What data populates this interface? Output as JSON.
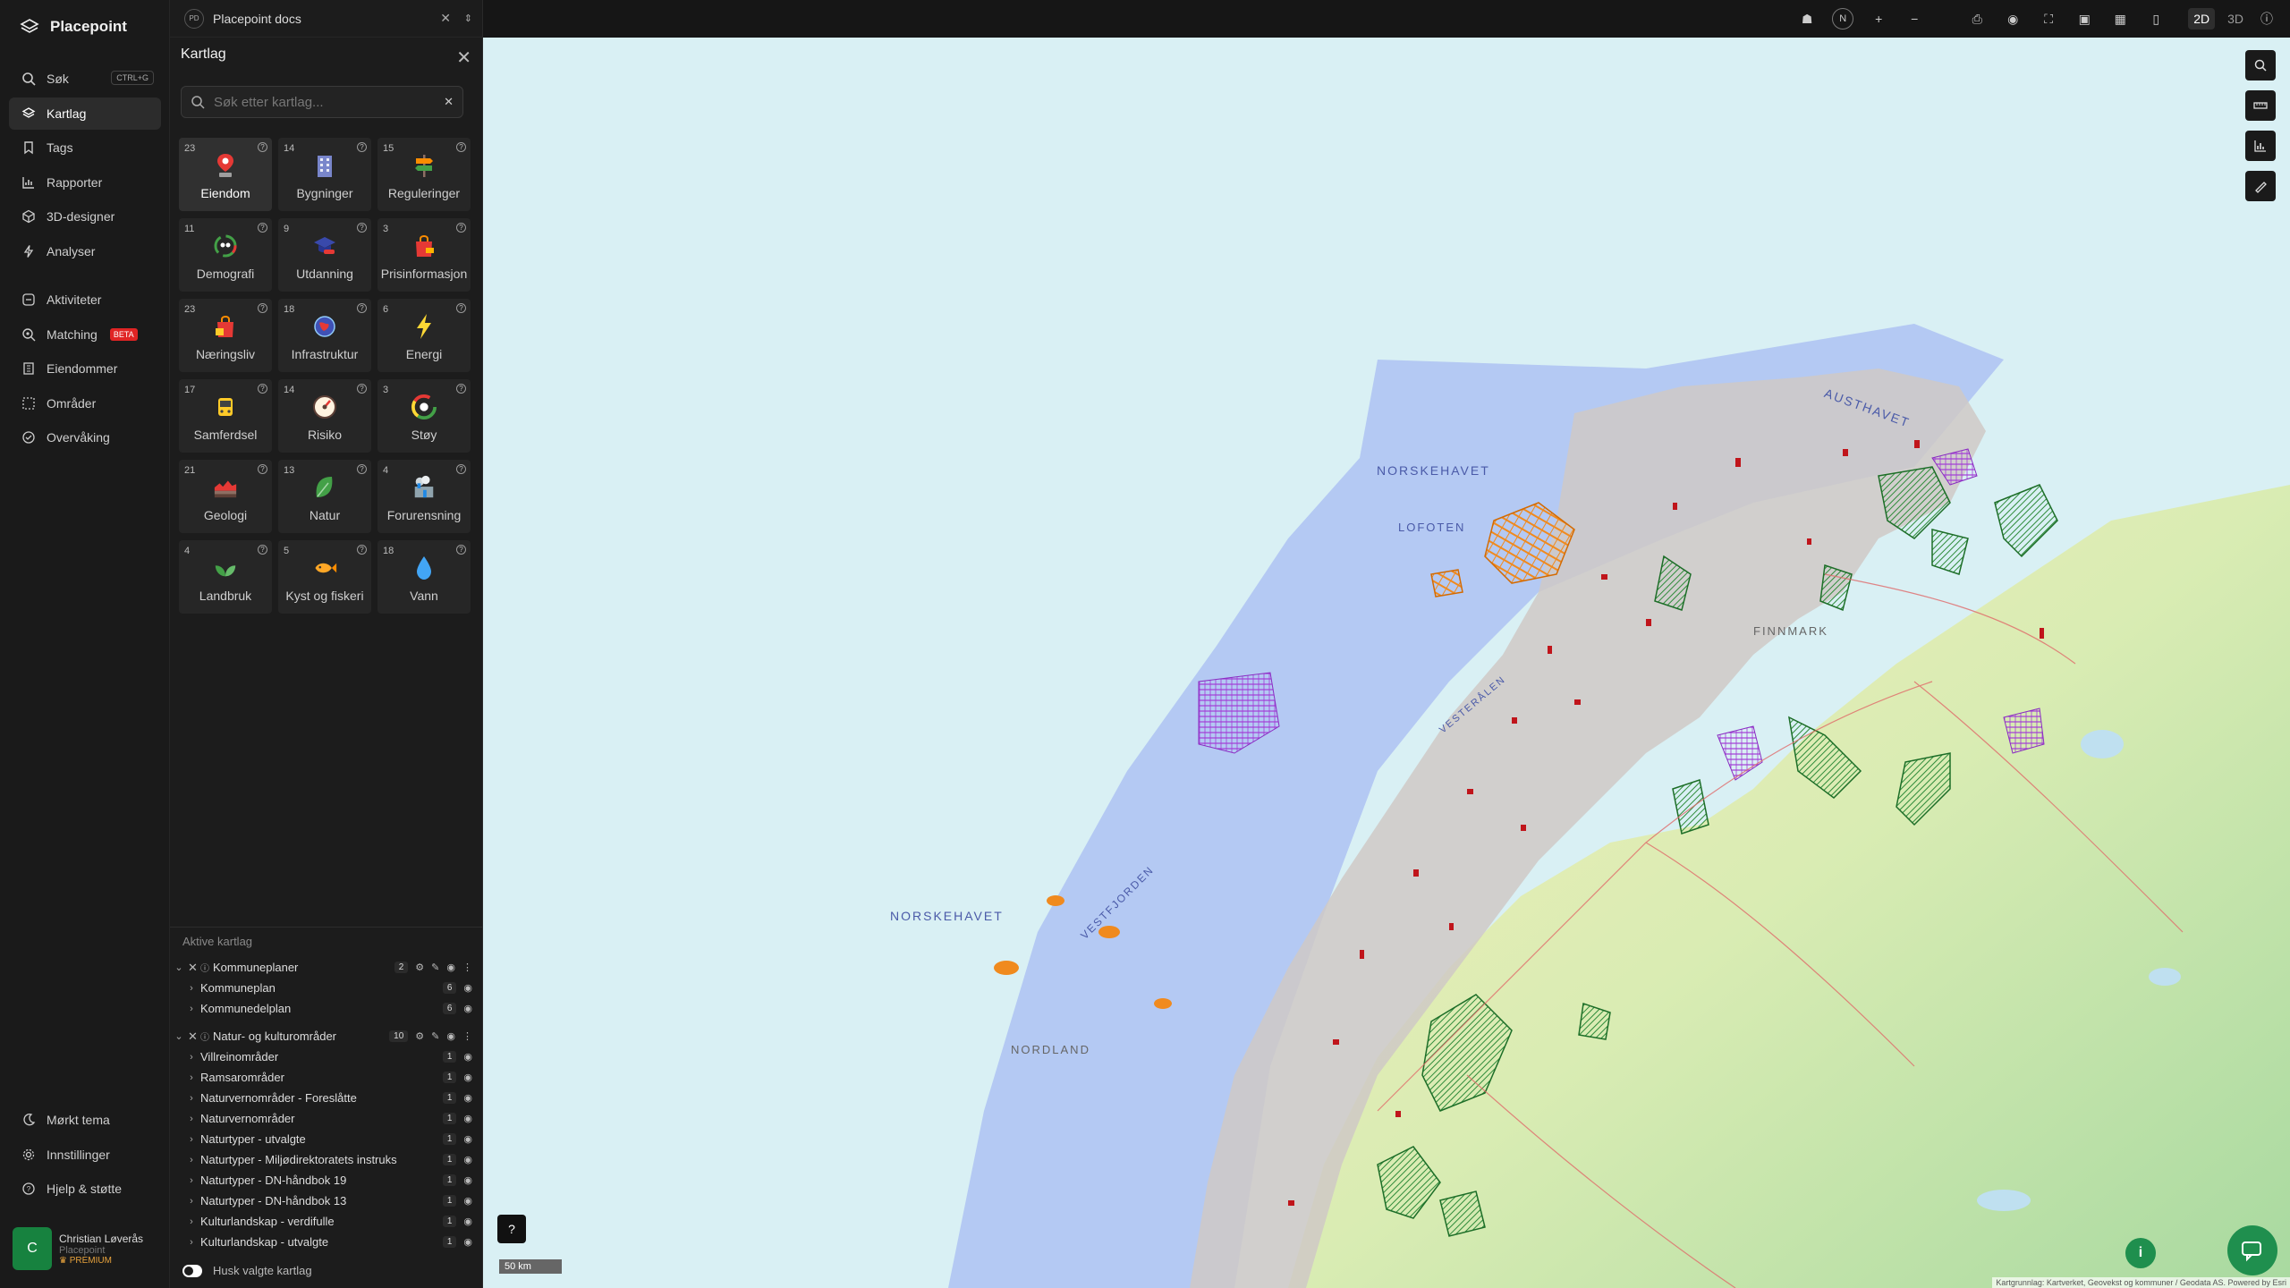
{
  "brand": {
    "name": "Placepoint"
  },
  "nav": {
    "items": [
      {
        "label": "Søk",
        "kbd": "CTRL+G"
      },
      {
        "label": "Kartlag"
      },
      {
        "label": "Tags"
      },
      {
        "label": "Rapporter"
      },
      {
        "label": "3D-designer"
      },
      {
        "label": "Analyser"
      },
      {
        "label": "Aktiviteter"
      },
      {
        "label": "Matching",
        "badge": "BETA"
      },
      {
        "label": "Eiendommer"
      },
      {
        "label": "Områder"
      },
      {
        "label": "Overvåking"
      }
    ],
    "bottom": [
      {
        "label": "Mørkt tema"
      },
      {
        "label": "Innstillinger"
      },
      {
        "label": "Hjelp & støtte"
      }
    ]
  },
  "user": {
    "initial": "C",
    "name": "Christian Løverås",
    "company": "Placepoint",
    "plan": "PREMIUM"
  },
  "workspace": {
    "badge": "PD",
    "name": "Placepoint docs"
  },
  "panel": {
    "title": "Kartlag",
    "search_placeholder": "Søk etter kartlag...",
    "info": "?"
  },
  "categories": [
    {
      "count": "23",
      "label": "Eiendom"
    },
    {
      "count": "14",
      "label": "Bygninger"
    },
    {
      "count": "15",
      "label": "Reguleringer"
    },
    {
      "count": "11",
      "label": "Demografi"
    },
    {
      "count": "9",
      "label": "Utdanning"
    },
    {
      "count": "3",
      "label": "Prisinformasjon"
    },
    {
      "count": "23",
      "label": "Næringsliv"
    },
    {
      "count": "18",
      "label": "Infrastruktur"
    },
    {
      "count": "6",
      "label": "Energi"
    },
    {
      "count": "17",
      "label": "Samferdsel"
    },
    {
      "count": "14",
      "label": "Risiko"
    },
    {
      "count": "3",
      "label": "Støy"
    },
    {
      "count": "21",
      "label": "Geologi"
    },
    {
      "count": "13",
      "label": "Natur"
    },
    {
      "count": "4",
      "label": "Forurensning"
    },
    {
      "count": "4",
      "label": "Landbruk"
    },
    {
      "count": "5",
      "label": "Kyst og fiskeri"
    },
    {
      "count": "18",
      "label": "Vann"
    }
  ],
  "active": {
    "title": "Aktive kartlag",
    "remember": "Husk valgte kartlag",
    "groups": [
      {
        "name": "Kommuneplaner",
        "count": "2",
        "layers": [
          {
            "name": "Kommuneplan",
            "count": "6"
          },
          {
            "name": "Kommunedelplan",
            "count": "6"
          }
        ]
      },
      {
        "name": "Natur- og kulturområder",
        "count": "10",
        "layers": [
          {
            "name": "Villreinområder",
            "count": "1"
          },
          {
            "name": "Ramsarområder",
            "count": "1"
          },
          {
            "name": "Naturvernområder - Foreslåtte",
            "count": "1"
          },
          {
            "name": "Naturvernområder",
            "count": "1"
          },
          {
            "name": "Naturtyper - utvalgte",
            "count": "1"
          },
          {
            "name": "Naturtyper - Miljødirektoratets instruks",
            "count": "1"
          },
          {
            "name": "Naturtyper - DN-håndbok 19",
            "count": "1"
          },
          {
            "name": "Naturtyper - DN-håndbok 13",
            "count": "1"
          },
          {
            "name": "Kulturlandskap - verdifulle",
            "count": "1"
          },
          {
            "name": "Kulturlandskap - utvalgte",
            "count": "1"
          }
        ]
      }
    ]
  },
  "topbar": {
    "north": "N",
    "zoom_in": "+",
    "zoom_out": "−",
    "mode_2d": "2D",
    "mode_3d": "3D"
  },
  "map": {
    "scale": "50 km",
    "help": "?",
    "info": "i",
    "attribution": "Kartgrunnlag: Kartverket, Geovekst og kommuner / Geodata AS. Powered by Esri",
    "labels": {
      "norskehavet1": "NORSKEHAVET",
      "norskehavet2": "NORSKEHAVET",
      "austhavet": "AUSTHAVET",
      "nordland": "NORDLAND",
      "finnmark": "FINNMARK",
      "lofoten": "LOFOTEN",
      "vestfjorden": "VESTFJORDEN",
      "vesteralen": "VESTERÅLEN"
    }
  }
}
